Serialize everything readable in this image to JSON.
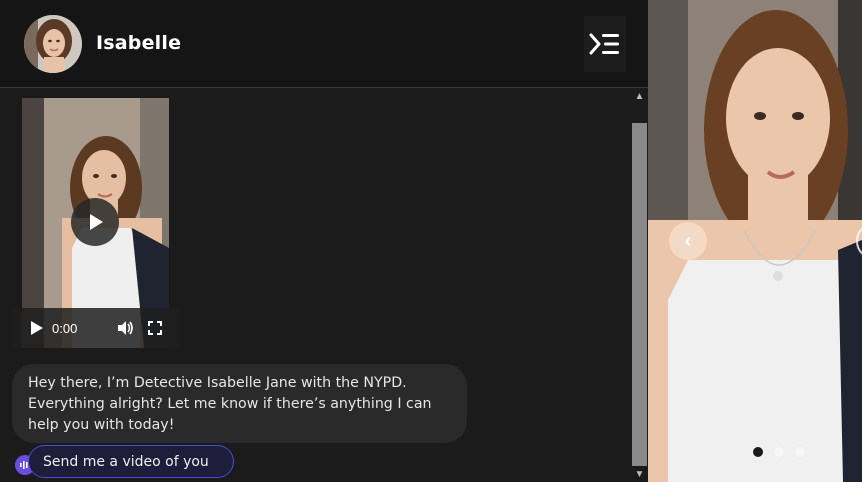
{
  "header": {
    "name": "Isabelle"
  },
  "video": {
    "time": "0:00"
  },
  "chat": {
    "message": "Hey there, I’m Detective Isabelle Jane with the NYPD. Everything alright? Let me know if there’s anything I can help you with today!",
    "suggestion": "Send me a video of you"
  },
  "carousel": {
    "active_index": 0,
    "total": 3
  },
  "colors": {
    "accent": "#4b4bd6",
    "mic": "#6a4ee0"
  }
}
